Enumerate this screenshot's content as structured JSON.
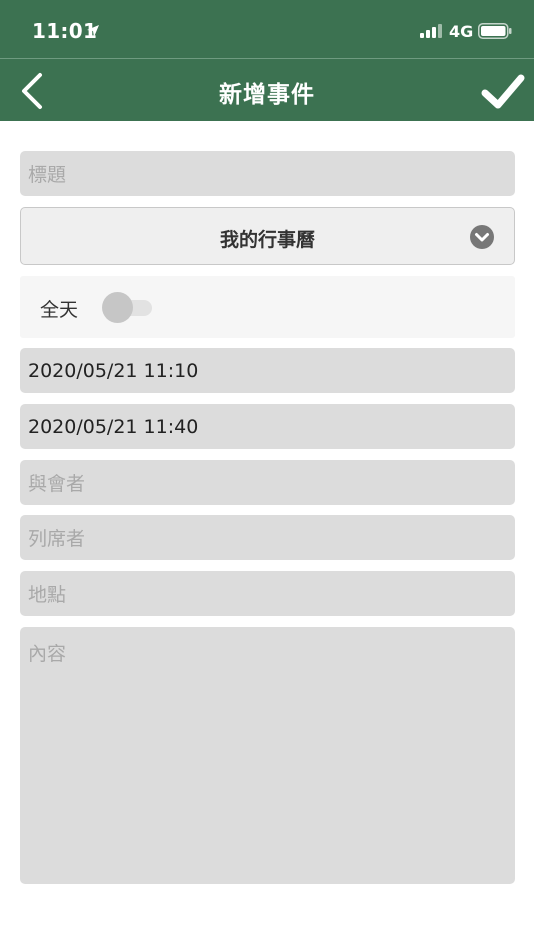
{
  "status_bar": {
    "time": "11:01",
    "network": "4G",
    "icons": [
      "location-arrow-icon",
      "signal-icon",
      "battery-icon"
    ]
  },
  "nav": {
    "title": "新增事件",
    "back_icon": "chevron-left-icon",
    "done_icon": "checkmark-icon"
  },
  "form": {
    "title_placeholder": "標題",
    "calendar": "我的行事曆",
    "all_day_label": "全天",
    "all_day_on": false,
    "start_time": "2020/05/21 11:10",
    "end_time": "2020/05/21 11:40",
    "attendees_placeholder": "與會者",
    "participants_placeholder": "列席者",
    "location_placeholder": "地點",
    "content_placeholder": "內容"
  },
  "colors": {
    "header": "#3c7251",
    "field_bg": "#dcdcdc",
    "placeholder": "#a9a9a9"
  }
}
